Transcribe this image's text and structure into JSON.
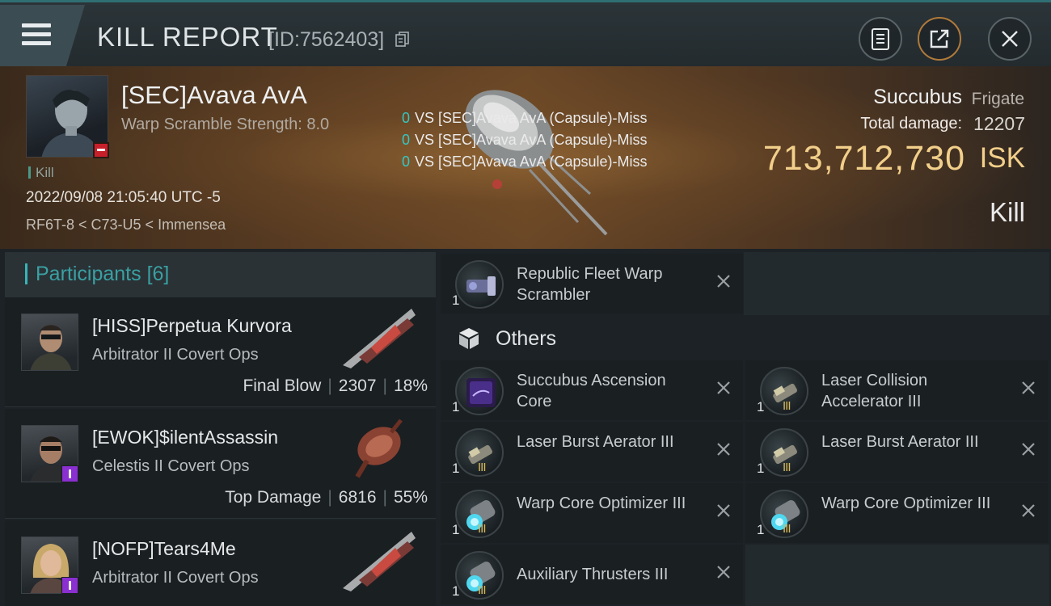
{
  "header": {
    "title": "KILL REPORT",
    "report_id": "[ID:7562403]"
  },
  "victim": {
    "name": "[SEC]Avava AvA",
    "warp_scramble": "Warp Scramble Strength: 8.0",
    "tag": "Kill",
    "datetime": "2022/09/08 21:05:40 UTC -5",
    "location": "RF6T-8 < C73-U5 < Immensea",
    "vs_lines": [
      {
        "count": "0",
        "text": "VS [SEC]Avava AvA (Capsule)-Miss"
      },
      {
        "count": "0",
        "text": "VS [SEC]Avava AvA (Capsule)-Miss"
      },
      {
        "count": "0",
        "text": "VS [SEC]Avava AvA (Capsule)-Miss"
      }
    ],
    "ship_name": "Succubus",
    "ship_class": "Frigate",
    "total_damage_label": "Total damage:",
    "total_damage": "12207",
    "isk_value": "713,712,730",
    "isk_unit": "ISK",
    "result": "Kill"
  },
  "participants": {
    "label": "Participants",
    "count": "[6]",
    "list": [
      {
        "name": "[HISS]Perpetua Kurvora",
        "ship": "Arbitrator II Covert Ops",
        "role": "Final Blow",
        "damage": "2307",
        "percent": "18%"
      },
      {
        "name": "[EWOK]$ilentAssassin",
        "ship": "Celestis II Covert Ops",
        "role": "Top Damage",
        "damage": "6816",
        "percent": "55%"
      },
      {
        "name": "[NOFP]Tears4Me",
        "ship": "Arbitrator II Covert Ops",
        "role": "",
        "damage": "",
        "percent": ""
      }
    ]
  },
  "items": {
    "top": {
      "name": "Republic Fleet Warp Scrambler",
      "qty": "1"
    },
    "others_label": "Others",
    "others": [
      {
        "name": "Succubus Ascension Core",
        "qty": "1",
        "tier": ""
      },
      {
        "name": "Laser Collision Accelerator III",
        "qty": "1",
        "tier": "III"
      },
      {
        "name": "Laser Burst Aerator III",
        "qty": "1",
        "tier": "III"
      },
      {
        "name": "Laser Burst Aerator III",
        "qty": "1",
        "tier": "III"
      },
      {
        "name": "Warp Core Optimizer III",
        "qty": "1",
        "tier": "III"
      },
      {
        "name": "Warp Core Optimizer III",
        "qty": "1",
        "tier": "III"
      },
      {
        "name": "Auxiliary Thrusters III",
        "qty": "1",
        "tier": "III"
      }
    ]
  },
  "colors": {
    "accent_teal": "#38b4b6",
    "isk_gold": "#f2cf8a",
    "badge_red": "#c8202a",
    "badge_purple": "#8a2fd0"
  },
  "icons": {
    "menu": "hamburger-menu-icon",
    "copy": "copy-icon",
    "clipboard": "clipboard-icon",
    "share": "share-icon",
    "close": "close-icon",
    "remove": "close-x-icon",
    "box": "cube-icon"
  }
}
